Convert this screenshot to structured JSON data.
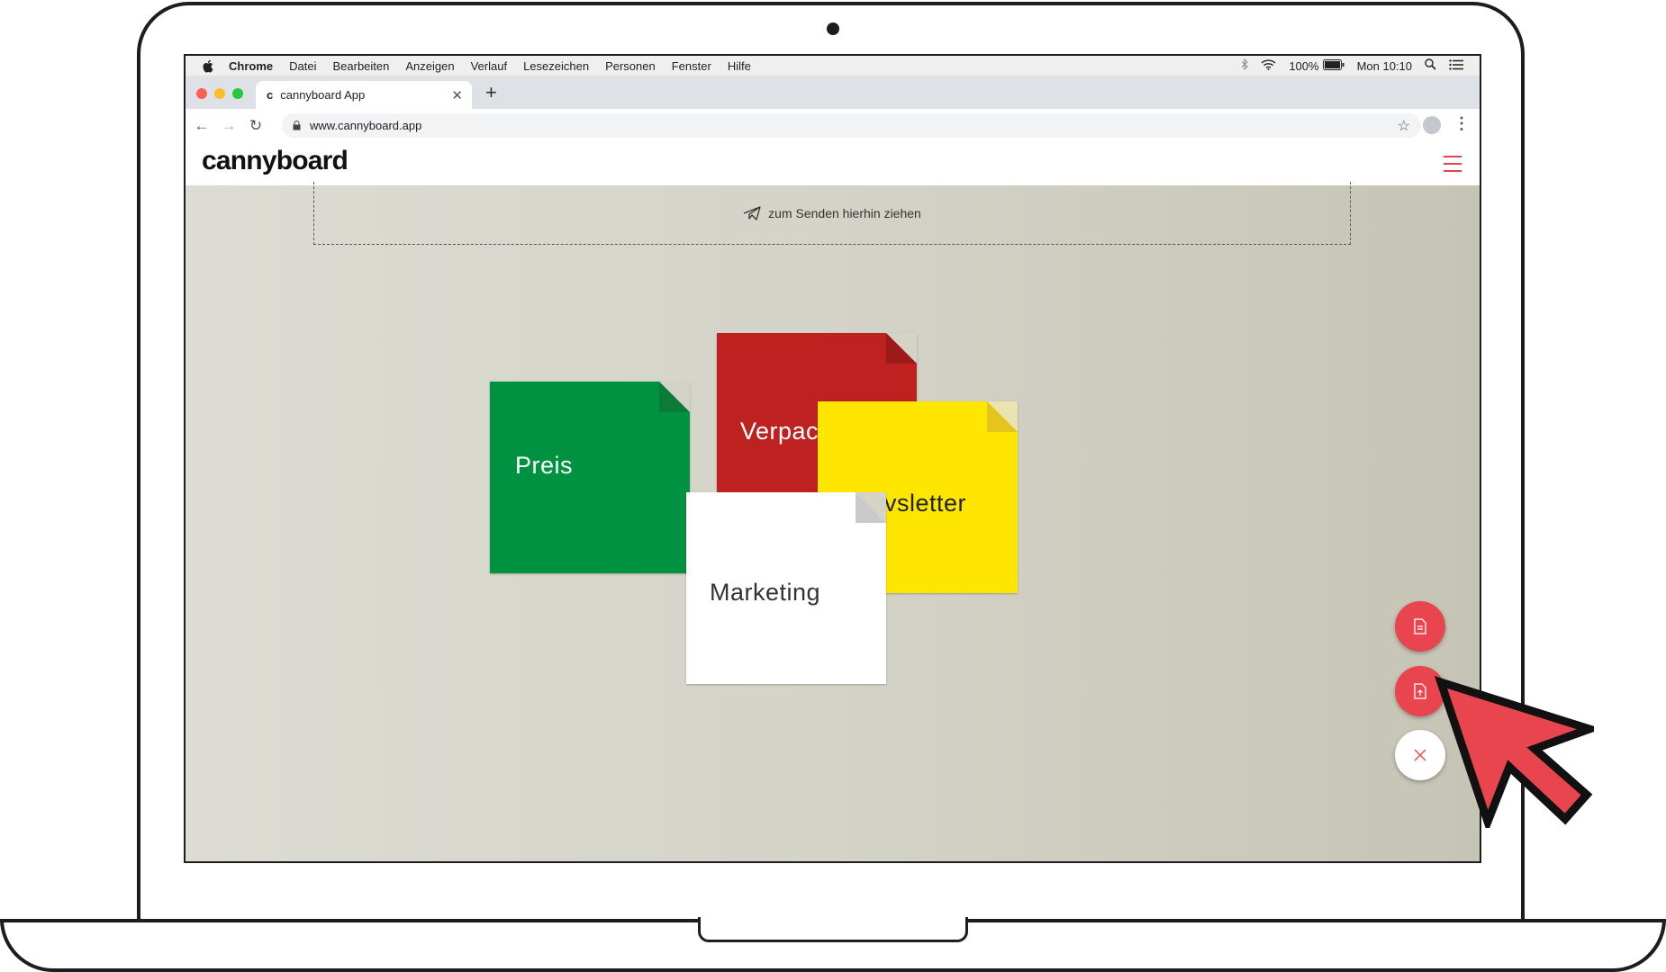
{
  "menubar": {
    "apple_icon": "apple-icon",
    "app_name": "Chrome",
    "items": [
      "Datei",
      "Bearbeiten",
      "Anzeigen",
      "Verlauf",
      "Lesezeichen",
      "Personen",
      "Fenster",
      "Hilfe"
    ],
    "battery": "100%",
    "clock": "Mon 10:10"
  },
  "browser": {
    "tab_title": "cannyboard App",
    "tab_favicon": "c",
    "new_tab": "+",
    "url": "www.cannyboard.app"
  },
  "app": {
    "logo": "cannyboard",
    "dropzone_text": "zum Senden hierhin ziehen"
  },
  "notes": [
    {
      "label": "Preis",
      "color": "#009240"
    },
    {
      "label": "Verpac",
      "color": "#be2220"
    },
    {
      "label": "vsletter",
      "color": "#ffe600"
    },
    {
      "label": "Marketing",
      "color": "#ffffff"
    }
  ],
  "fabs": {
    "note_icon": "note-icon",
    "upload_icon": "upload-icon",
    "close_icon": "close-icon",
    "accent": "#e8454e"
  }
}
